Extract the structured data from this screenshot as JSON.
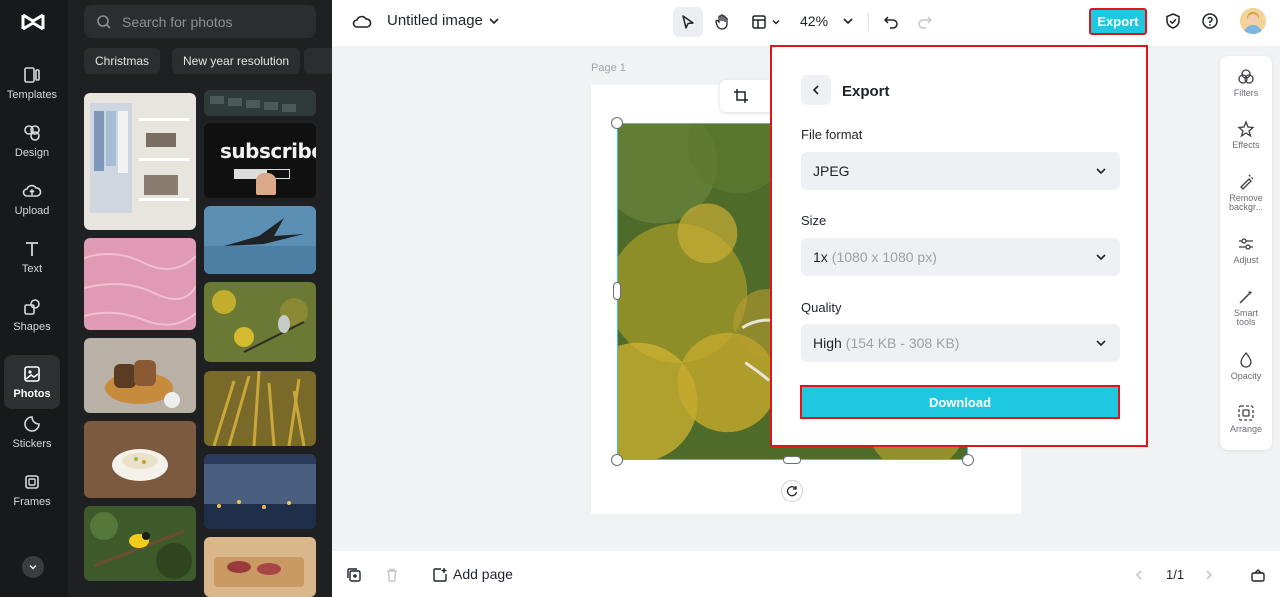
{
  "app": {
    "title": "Untitled image",
    "zoom": "42%"
  },
  "rail": {
    "items": [
      {
        "label": "Templates",
        "icon": "templates-icon"
      },
      {
        "label": "Design",
        "icon": "design-icon"
      },
      {
        "label": "Upload",
        "icon": "upload-icon"
      },
      {
        "label": "Text",
        "icon": "text-icon"
      },
      {
        "label": "Shapes",
        "icon": "shapes-icon"
      },
      {
        "label": "Photos",
        "icon": "photos-icon",
        "active": true
      },
      {
        "label": "Stickers",
        "icon": "stickers-icon"
      },
      {
        "label": "Frames",
        "icon": "frames-icon"
      }
    ]
  },
  "panel": {
    "search_placeholder": "Search for photos",
    "chips": [
      "Christmas",
      "New year resolution"
    ],
    "thumb_text": "subscribe"
  },
  "topbar": {
    "export_label": "Export"
  },
  "canvas": {
    "page_label": "Page 1"
  },
  "tools": [
    {
      "label": "Filters",
      "icon": "filters-icon"
    },
    {
      "label": "Effects",
      "icon": "effects-icon"
    },
    {
      "label": "Remove backgr...",
      "icon": "remove-background-icon"
    },
    {
      "label": "Adjust",
      "icon": "adjust-icon"
    },
    {
      "label": "Smart tools",
      "icon": "smart-tools-icon"
    },
    {
      "label": "Opacity",
      "icon": "opacity-icon"
    },
    {
      "label": "Arrange",
      "icon": "arrange-icon"
    }
  ],
  "export_panel": {
    "title": "Export",
    "file_format_label": "File format",
    "file_format_value": "JPEG",
    "size_label": "Size",
    "size_value": "1x",
    "size_detail": "(1080 x 1080 px)",
    "quality_label": "Quality",
    "quality_value": "High",
    "quality_detail": "(154 KB - 308 KB)",
    "download_label": "Download"
  },
  "bottombar": {
    "add_page_label": "Add page",
    "page_count": "1/1"
  },
  "colors": {
    "accent": "#1ec8e0",
    "highlight": "#e0141a",
    "rail_bg": "#18191b",
    "panel_bg": "#1f2022"
  }
}
